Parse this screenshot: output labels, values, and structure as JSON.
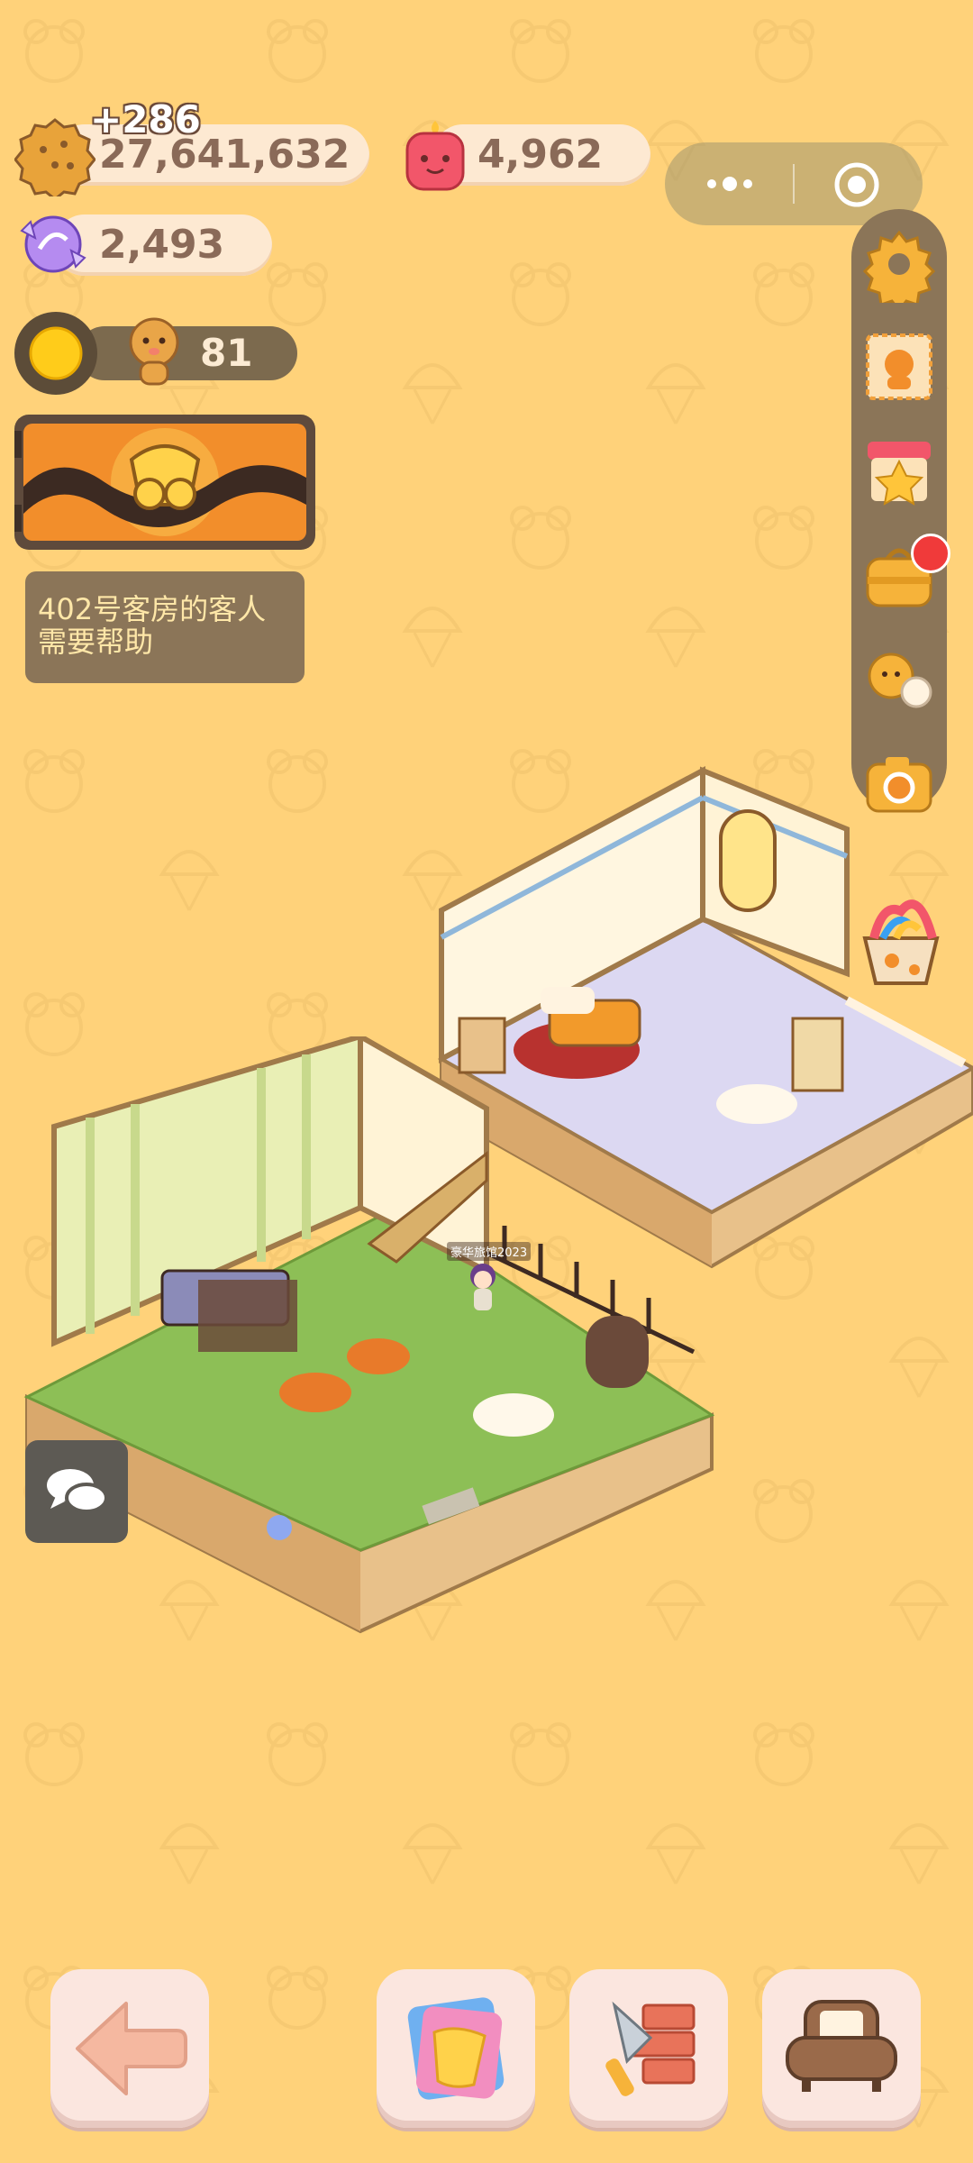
{
  "resources": {
    "cookies": {
      "value": "27,641,632",
      "gain": "+286",
      "icon": "cookie-icon"
    },
    "jelly": {
      "value": "4,962",
      "icon": "jelly-candle-icon"
    },
    "gems": {
      "value": "2,493",
      "icon": "candy-gem-icon"
    }
  },
  "residents": {
    "count": "81",
    "icon": "gingerbread-icon",
    "sun_icon": "sun-icon"
  },
  "event_banner": {
    "icon": "film-reel-icon"
  },
  "hint": {
    "text_line1": "402号客房的客人",
    "text_line2": "需要帮助"
  },
  "character": {
    "name": "豪华旅馆2023"
  },
  "capsule": {
    "menu_icon": "more-dots-icon",
    "close_icon": "target-icon"
  },
  "side_menu": [
    {
      "name": "settings",
      "icon": "gear-icon"
    },
    {
      "name": "stamp",
      "icon": "stamp-icon"
    },
    {
      "name": "shop",
      "icon": "star-shop-icon"
    },
    {
      "name": "bag",
      "icon": "bag-icon",
      "badge": true
    },
    {
      "name": "friends",
      "icon": "friends-icon"
    },
    {
      "name": "camera",
      "icon": "camera-icon"
    }
  ],
  "colors": {
    "background": "#FFD27A",
    "panel": "#8B7558",
    "hint_text": "#FFE7A8"
  }
}
